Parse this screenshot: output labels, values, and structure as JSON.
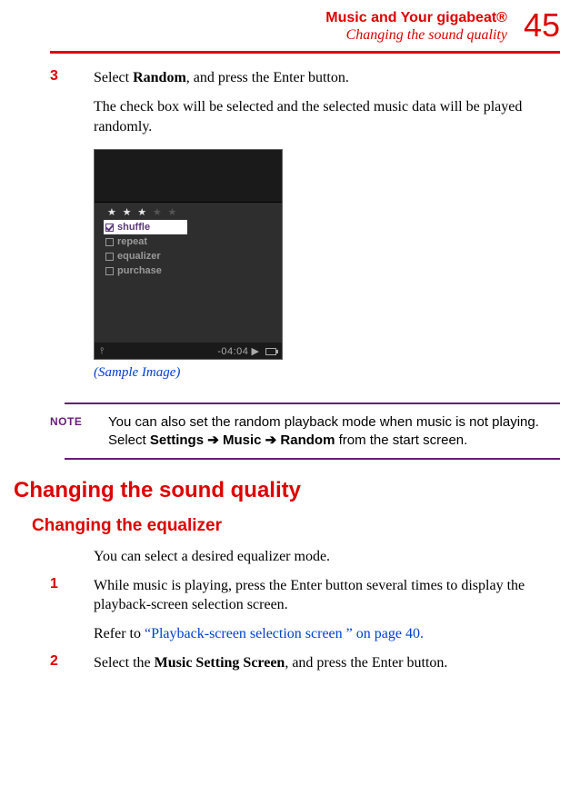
{
  "header": {
    "title": "Music and Your gigabeat®",
    "subtitle": "Changing the sound quality",
    "page_number": "45"
  },
  "step3": {
    "num": "3",
    "text_prefix": "Select ",
    "text_bold": "Random",
    "text_suffix": ", and press the Enter button.",
    "para": "The check box will be selected and the selected music data will be played randomly."
  },
  "device": {
    "stars_filled": "★ ★ ★",
    "stars_dim": " ★ ★",
    "items": [
      {
        "label": "shuffle",
        "checked": true,
        "active": true
      },
      {
        "label": "repeat",
        "checked": false,
        "active": false
      },
      {
        "label": "equalizer",
        "checked": false,
        "active": false
      },
      {
        "label": "purchase",
        "checked": false,
        "active": false
      }
    ],
    "time": "-04:04",
    "play_glyph": "▶"
  },
  "caption": "(Sample Image)",
  "note": {
    "label": "NOTE",
    "text_prefix": "You can also set the random playback mode when music is not playing. Select ",
    "path1": "Settings",
    "path2": "Music",
    "path3": "Random",
    "text_suffix": " from the start screen.",
    "arrow": "➔"
  },
  "h1": "Changing the sound quality",
  "h2": "Changing the equalizer",
  "eq_intro": "You can select a desired equalizer mode.",
  "eq_step1": {
    "num": "1",
    "text": "While music is playing, press the Enter button several times to display the playback-screen selection screen.",
    "refer_prefix": "Refer to ",
    "refer_link": "“Playback-screen selection screen ” on page 40."
  },
  "eq_step2": {
    "num": "2",
    "text_prefix": "Select the ",
    "text_bold": "Music Setting Screen",
    "text_suffix": ", and press the Enter button."
  }
}
